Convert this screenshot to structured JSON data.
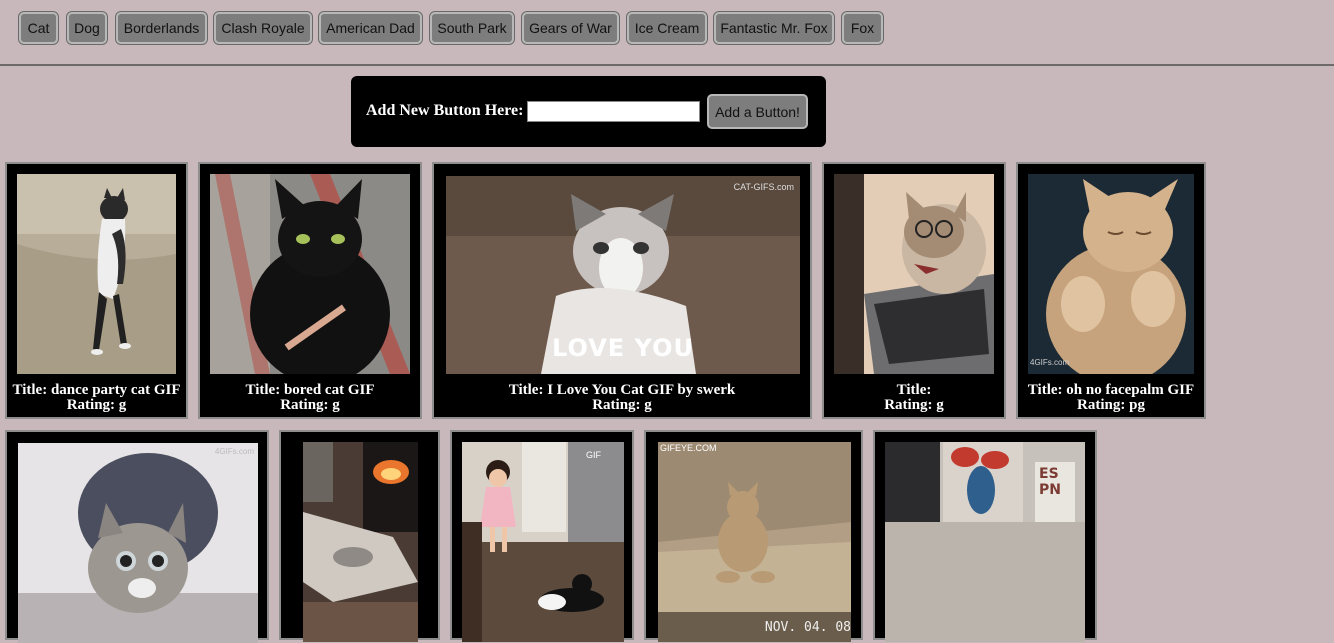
{
  "topics": [
    "Cat",
    "Dog",
    "Borderlands",
    "Clash Royale",
    "American Dad",
    "South Park",
    "Gears of War",
    "Ice Cream",
    "Fantastic Mr. Fox",
    "Fox"
  ],
  "add_form": {
    "label": "Add New Button Here:",
    "input_value": "",
    "button_label": "Add a Button!"
  },
  "gifs": [
    {
      "title_prefix": "Title:",
      "title": "dance party cat GIF",
      "rating_prefix": "Rating:",
      "rating": "g",
      "image_text": ""
    },
    {
      "title_prefix": "Title:",
      "title": "bored cat GIF",
      "rating_prefix": "Rating:",
      "rating": "g",
      "image_text": ""
    },
    {
      "title_prefix": "Title:",
      "title": "I Love You Cat GIF by swerk",
      "rating_prefix": "Rating:",
      "rating": "g",
      "image_text": "LOVE YOU",
      "watermark": "CAT-GIFS.com"
    },
    {
      "title_prefix": "Title:",
      "title": "",
      "rating_prefix": "Rating:",
      "rating": "g",
      "image_text": ""
    },
    {
      "title_prefix": "Title:",
      "title": "oh no facepalm GIF",
      "rating_prefix": "Rating:",
      "rating": "pg",
      "image_text": "",
      "watermark": "4GIFs.com"
    },
    {
      "image_text": "",
      "watermark": "4GIFs.com"
    },
    {
      "image_text": ""
    },
    {
      "image_text": "",
      "watermark": "GIF"
    },
    {
      "image_text": "NOV. 04. 08",
      "watermark": "GIFEYE.COM"
    },
    {
      "image_text": "ES PN"
    }
  ]
}
